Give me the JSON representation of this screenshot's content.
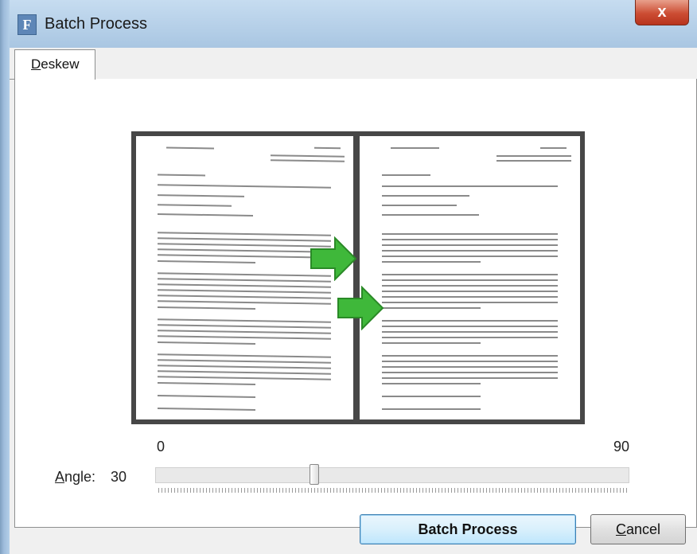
{
  "window": {
    "title": "Batch Process",
    "app_icon_letter": "F",
    "close_symbol": "x",
    "icon_name": "app-icon",
    "close_icon_name": "close-icon"
  },
  "tabs": [
    {
      "label": "Deskew",
      "mnemonic": "D",
      "rest": "eskew",
      "active": true
    }
  ],
  "preview": {
    "arrow_icon_name": "arrow-right-icon",
    "arrow_color": "#3fb83a",
    "arrow_count": 2
  },
  "angle": {
    "label": "Angle:",
    "label_mnemonic": "A",
    "label_rest": "ngle:",
    "value": "30",
    "min_label": "0",
    "max_label": "90",
    "slider_fraction": 0.333
  },
  "buttons": {
    "batch_process": "Batch Process",
    "cancel": "Cancel",
    "cancel_mnemonic": "C",
    "cancel_rest": "ancel"
  },
  "colors": {
    "title_bar": "#b9d4ec",
    "close_button": "#cc4d33",
    "primary_button": "#bee6fd",
    "preview_bg": "#474747"
  }
}
